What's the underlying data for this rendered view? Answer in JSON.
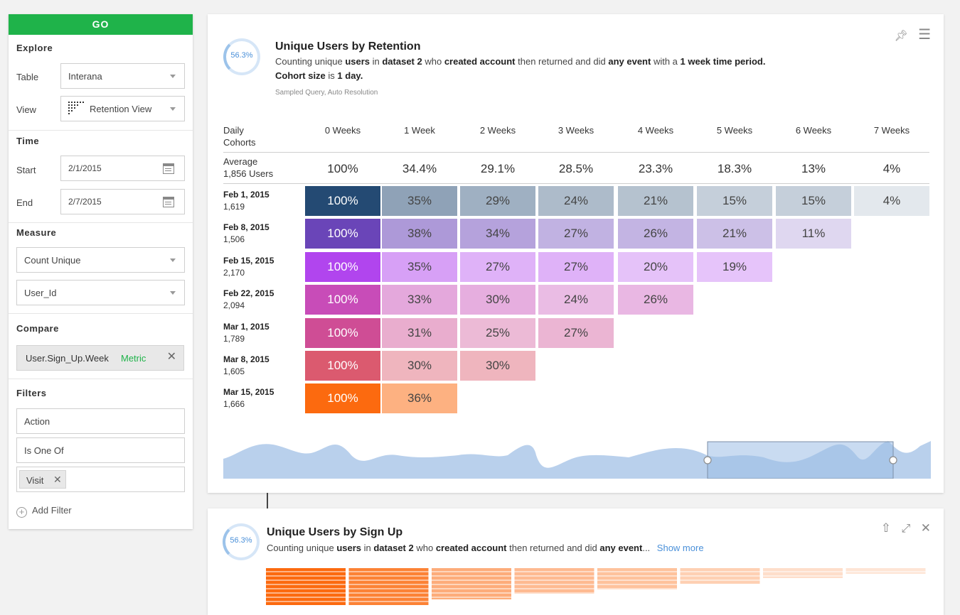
{
  "sidebar": {
    "go_label": "GO",
    "explore": {
      "title": "Explore",
      "table_label": "Table",
      "table_value": "Interana",
      "view_label": "View",
      "view_value": "Retention View"
    },
    "time": {
      "title": "Time",
      "start_label": "Start",
      "start_value": "2/1/2015",
      "end_label": "End",
      "end_value": "2/7/2015"
    },
    "measure": {
      "title": "Measure",
      "aggregation": "Count Unique",
      "column": "User_Id"
    },
    "compare": {
      "title": "Compare",
      "chip_label": "User.Sign_Up.Week",
      "chip_tag": "Metric"
    },
    "filters": {
      "title": "Filters",
      "field": "Action",
      "operator": "Is One Of",
      "value_chip": "Visit",
      "add_label": "Add Filter"
    }
  },
  "card1": {
    "ring_value": "56.3%",
    "title": "Unique Users by Retention",
    "desc_parts": [
      "Counting unique ",
      "users",
      " in ",
      "dataset 2",
      " who ",
      "created account",
      " then returned and did ",
      "any event",
      " with a ",
      "1 week time period.",
      "Cohort size",
      " is ",
      "1 day."
    ],
    "subnote": "Sampled Query, Auto Resolution",
    "header_first": [
      "Daily",
      "Cohorts"
    ],
    "columns": [
      "0 Weeks",
      "1 Week",
      "2 Weeks",
      "3 Weeks",
      "4 Weeks",
      "5 Weeks",
      "6 Weeks",
      "7 Weeks"
    ],
    "average": {
      "label": "Average",
      "users": "1,856 Users",
      "values": [
        "100%",
        "34.4%",
        "29.1%",
        "28.5%",
        "23.3%",
        "18.3%",
        "13%",
        "4%"
      ]
    },
    "rows": [
      {
        "date": "Feb 1, 2015",
        "count": "1,619",
        "values": [
          "100%",
          "35%",
          "29%",
          "24%",
          "21%",
          "15%",
          "15%",
          "4%"
        ],
        "color": "#244a73"
      },
      {
        "date": "Feb 8, 2015",
        "count": "1,506",
        "values": [
          "100%",
          "38%",
          "34%",
          "27%",
          "26%",
          "21%",
          "11%"
        ],
        "color": "#6a45b8"
      },
      {
        "date": "Feb 15, 2015",
        "count": "2,170",
        "values": [
          "100%",
          "35%",
          "27%",
          "27%",
          "20%",
          "19%"
        ],
        "color": "#b145ee"
      },
      {
        "date": "Feb 22, 2015",
        "count": "2,094",
        "values": [
          "100%",
          "33%",
          "30%",
          "24%",
          "26%"
        ],
        "color": "#c84cb8"
      },
      {
        "date": "Mar 1, 2015",
        "count": "1,789",
        "values": [
          "100%",
          "31%",
          "25%",
          "27%"
        ],
        "color": "#cf4d95"
      },
      {
        "date": "Mar 8, 2015",
        "count": "1,605",
        "values": [
          "100%",
          "30%",
          "30%"
        ],
        "color": "#db5a6f"
      },
      {
        "date": "Mar 15, 2015",
        "count": "1,666",
        "values": [
          "100%",
          "36%"
        ],
        "color": "#fc6a0f"
      }
    ]
  },
  "card2": {
    "ring_value": "56.3%",
    "title": "Unique Users by Sign Up",
    "desc_parts": [
      "Counting unique ",
      "users",
      " in ",
      "dataset 2",
      " who ",
      "created account",
      " then returned and did ",
      "any event",
      "..."
    ],
    "show_more": "Show more",
    "bar_color": "#fc6a0f"
  },
  "icons": {
    "pin": "pin-icon",
    "menu": "menu-icon",
    "share": "share-icon",
    "expand": "expand-icon",
    "close": "close-icon"
  }
}
